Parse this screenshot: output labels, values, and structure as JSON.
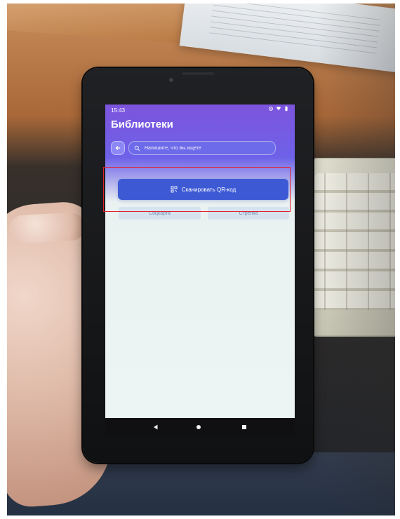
{
  "status": {
    "time": "15:43"
  },
  "header": {
    "title": "Библиотеки"
  },
  "search": {
    "placeholder": "Напишите, что вы ищете"
  },
  "actions": {
    "scan_label": "Сканировать QR-код"
  },
  "chips": [
    {
      "label": "Соцкарта"
    },
    {
      "label": "Стрелка"
    }
  ],
  "icons": {
    "back": "arrow-left-icon",
    "search": "search-icon",
    "qr": "qr-code-icon",
    "android_back": "nav-back-icon",
    "android_home": "nav-home-icon",
    "android_recent": "nav-recent-icon"
  },
  "colors": {
    "header_purple": "#7d54dd",
    "header_blue": "#6e62e8",
    "scan_button": "#3d5ad4",
    "chip_bg": "#d6e2ee",
    "chip_text": "#6e88ab",
    "selection_red": "#e1202b"
  }
}
